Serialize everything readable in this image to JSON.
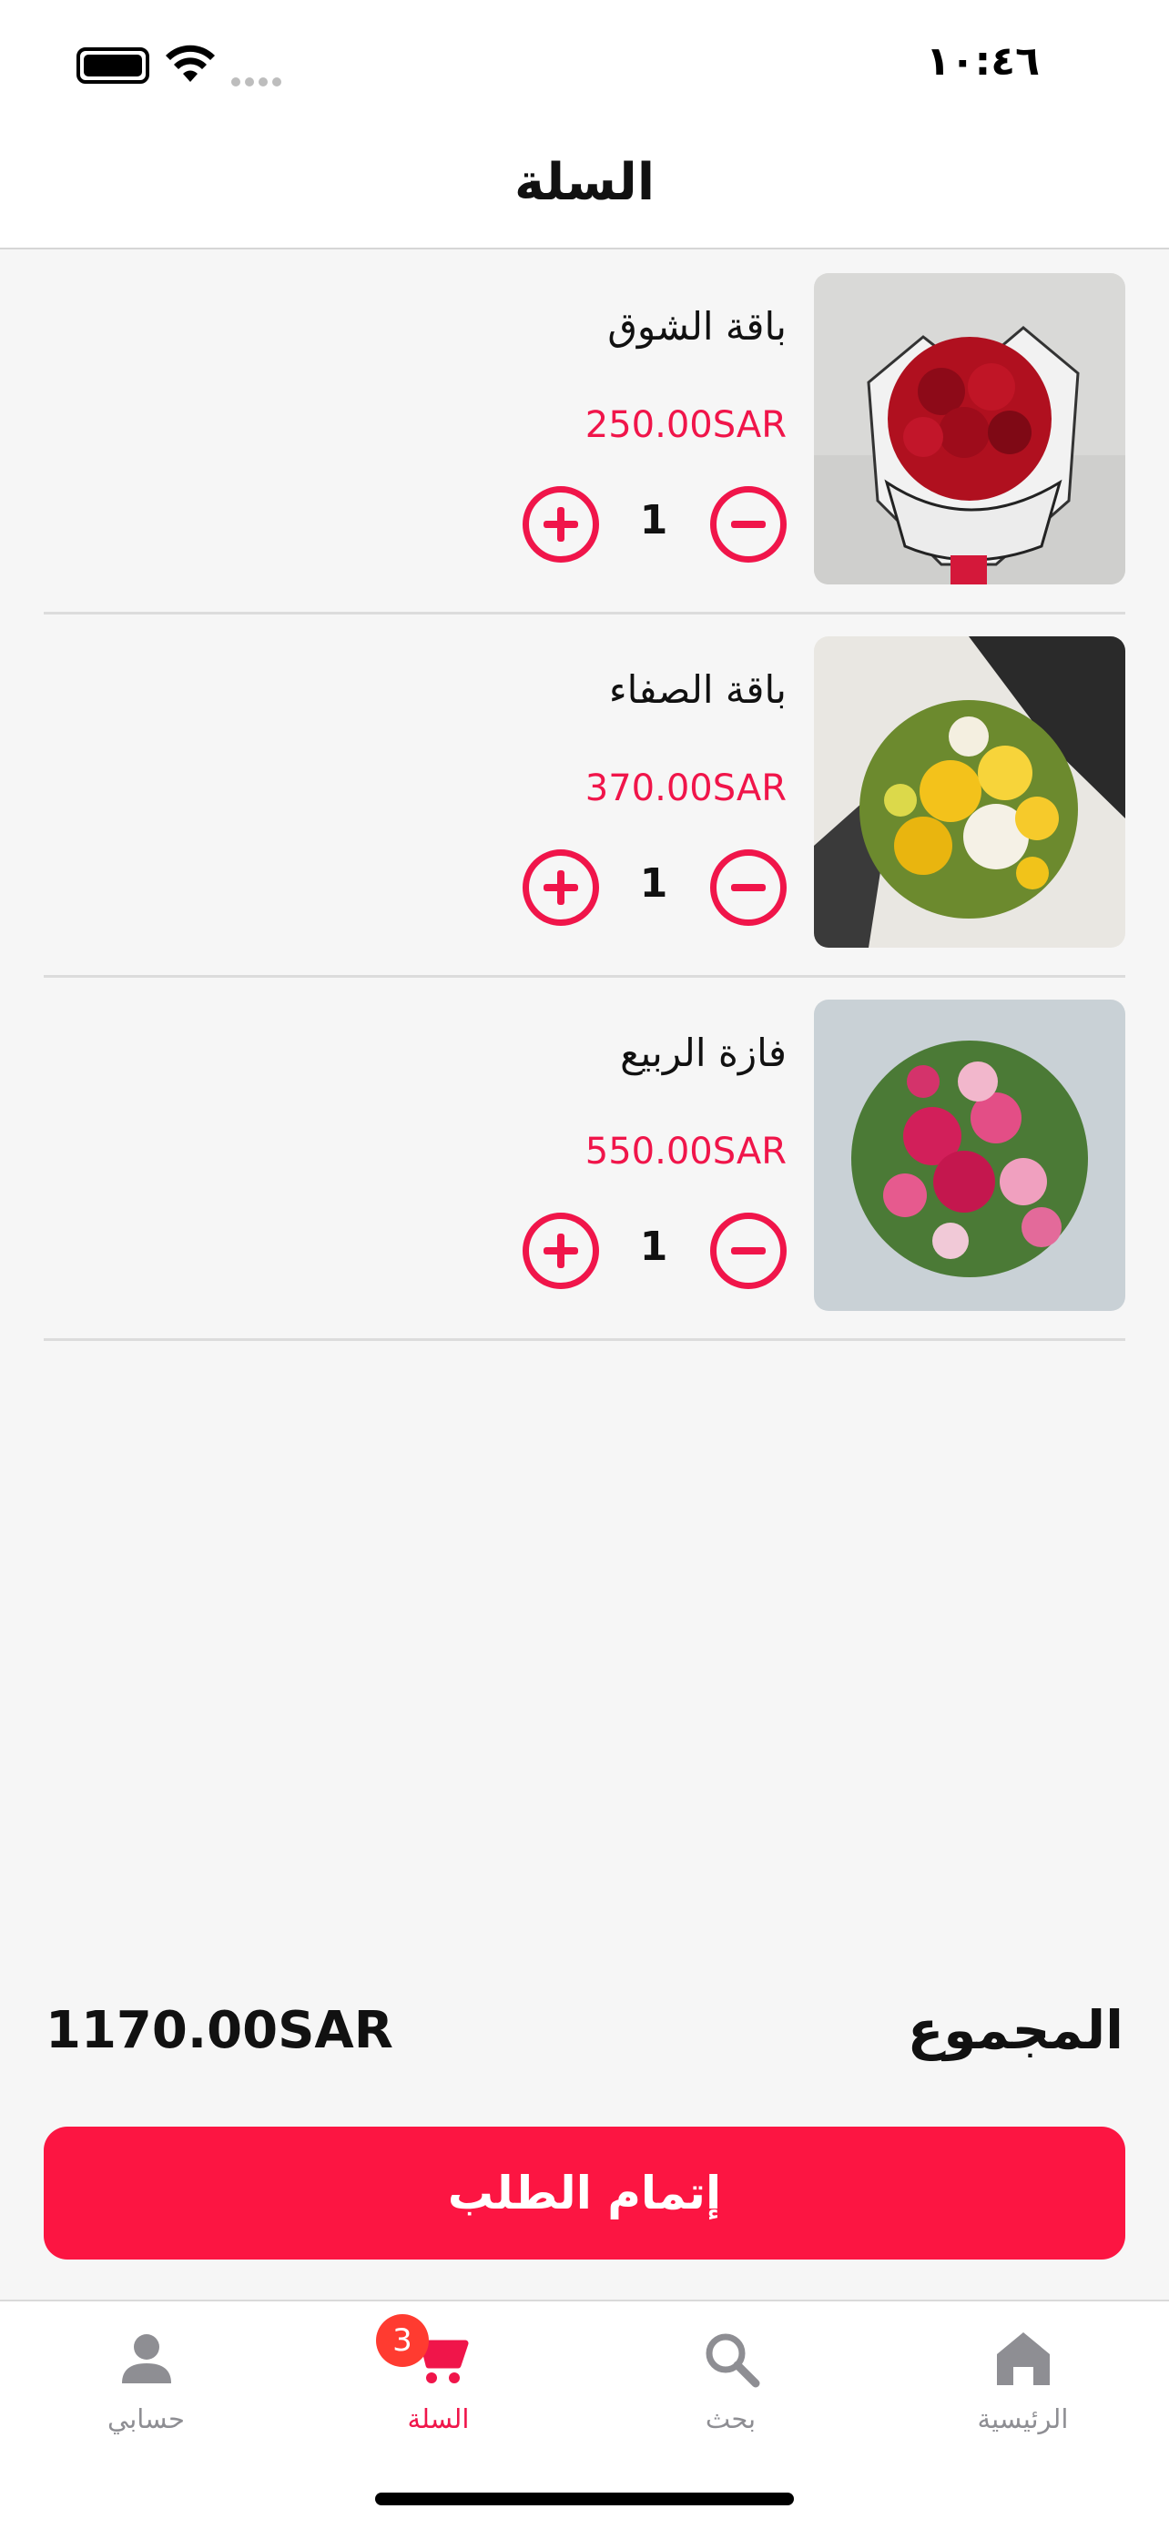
{
  "status_bar": {
    "time": "١٠:٤٦"
  },
  "header": {
    "title": "السلة"
  },
  "cart": {
    "items": [
      {
        "name": "باقة الشوق",
        "price": "250.00SAR",
        "quantity": "1",
        "image": "red-roses-bouquet"
      },
      {
        "name": "باقة الصفاء",
        "price": "370.00SAR",
        "quantity": "1",
        "image": "yellow-lilies-bouquet"
      },
      {
        "name": "فازة الربيع",
        "price": "550.00SAR",
        "quantity": "1",
        "image": "pink-flowers-vase"
      }
    ],
    "total_label": "المجموع",
    "total_value": "1170.00SAR",
    "checkout_label": "إتمام الطلب"
  },
  "tab_bar": {
    "tabs": [
      {
        "label": "حسابي",
        "icon": "person-icon"
      },
      {
        "label": "السلة",
        "icon": "cart-icon",
        "badge": "3"
      },
      {
        "label": "بحث",
        "icon": "search-icon"
      },
      {
        "label": "الرئيسية",
        "icon": "home-icon"
      }
    ],
    "active": "السلة"
  },
  "colors": {
    "accent": "#f0154a",
    "button": "#fc1542",
    "badge": "#ff3b30",
    "inactive": "#8e8e93"
  }
}
